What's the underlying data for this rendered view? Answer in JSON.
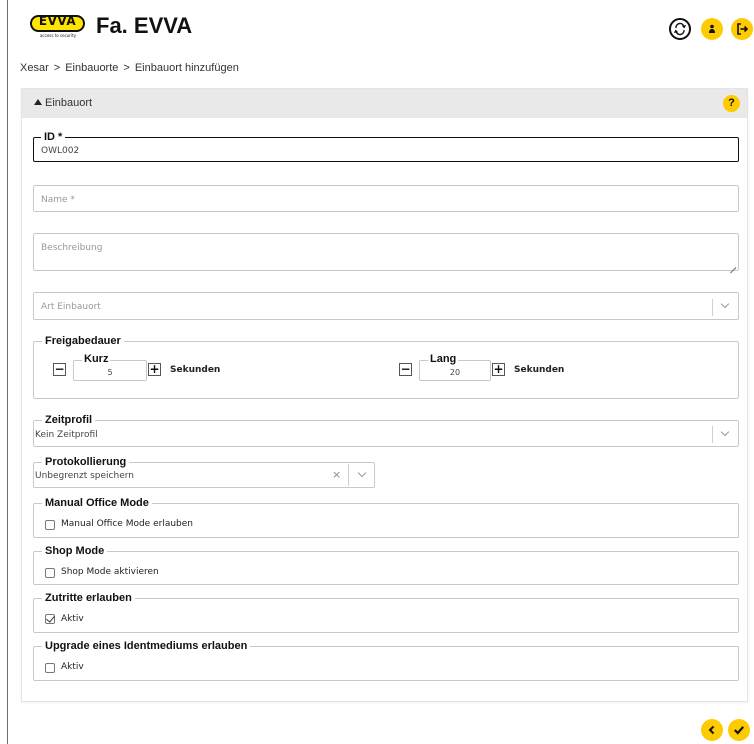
{
  "header": {
    "logo_text": "EVVA",
    "logo_tagline": "access to security",
    "title": "Fa. EVVA",
    "buttons": [
      {
        "icon": "sync-icon"
      },
      {
        "icon": "user-icon"
      },
      {
        "icon": "logout-icon"
      }
    ]
  },
  "breadcrumb": {
    "items": [
      "Xesar",
      "Einbauorte",
      "Einbauort hinzufügen"
    ],
    "separator": ">"
  },
  "section": {
    "title": "Einbauort",
    "help": "?"
  },
  "form": {
    "id": {
      "label": "ID *",
      "value": "OWL002"
    },
    "name": {
      "placeholder": "Name *"
    },
    "beschreibung": {
      "placeholder": "Beschreibung"
    },
    "art": {
      "placeholder": "Art Einbauort"
    },
    "freigabedauer": {
      "title": "Freigabedauer",
      "kurz": {
        "label": "Kurz",
        "value": "5",
        "unit": "Sekunden"
      },
      "lang": {
        "label": "Lang",
        "value": "20",
        "unit": "Sekunden"
      },
      "minus": "−",
      "plus": "+"
    },
    "zeitprofil": {
      "label": "Zeitprofil",
      "value": "Kein Zeitprofil"
    },
    "protokollierung": {
      "label": "Protokollierung",
      "value": "Unbegrenzt speichern",
      "clear": "×"
    },
    "manual_office_mode": {
      "title": "Manual Office Mode",
      "checkbox_label": "Manual Office Mode erlauben",
      "checked": false
    },
    "shop_mode": {
      "title": "Shop Mode",
      "checkbox_label": "Shop Mode aktivieren",
      "checked": false
    },
    "zutritte": {
      "title": "Zutritte erlauben",
      "checkbox_label": "Aktiv",
      "checked": true
    },
    "upgrade": {
      "title": "Upgrade eines Identmediums erlauben",
      "checkbox_label": "Aktiv",
      "checked": false
    }
  },
  "actions": [
    {
      "icon": "back-icon"
    },
    {
      "icon": "confirm-icon"
    }
  ],
  "colors": {
    "accent": "#fecb00",
    "section_header": "#e9e9e9",
    "border": "#c9c9c9"
  }
}
